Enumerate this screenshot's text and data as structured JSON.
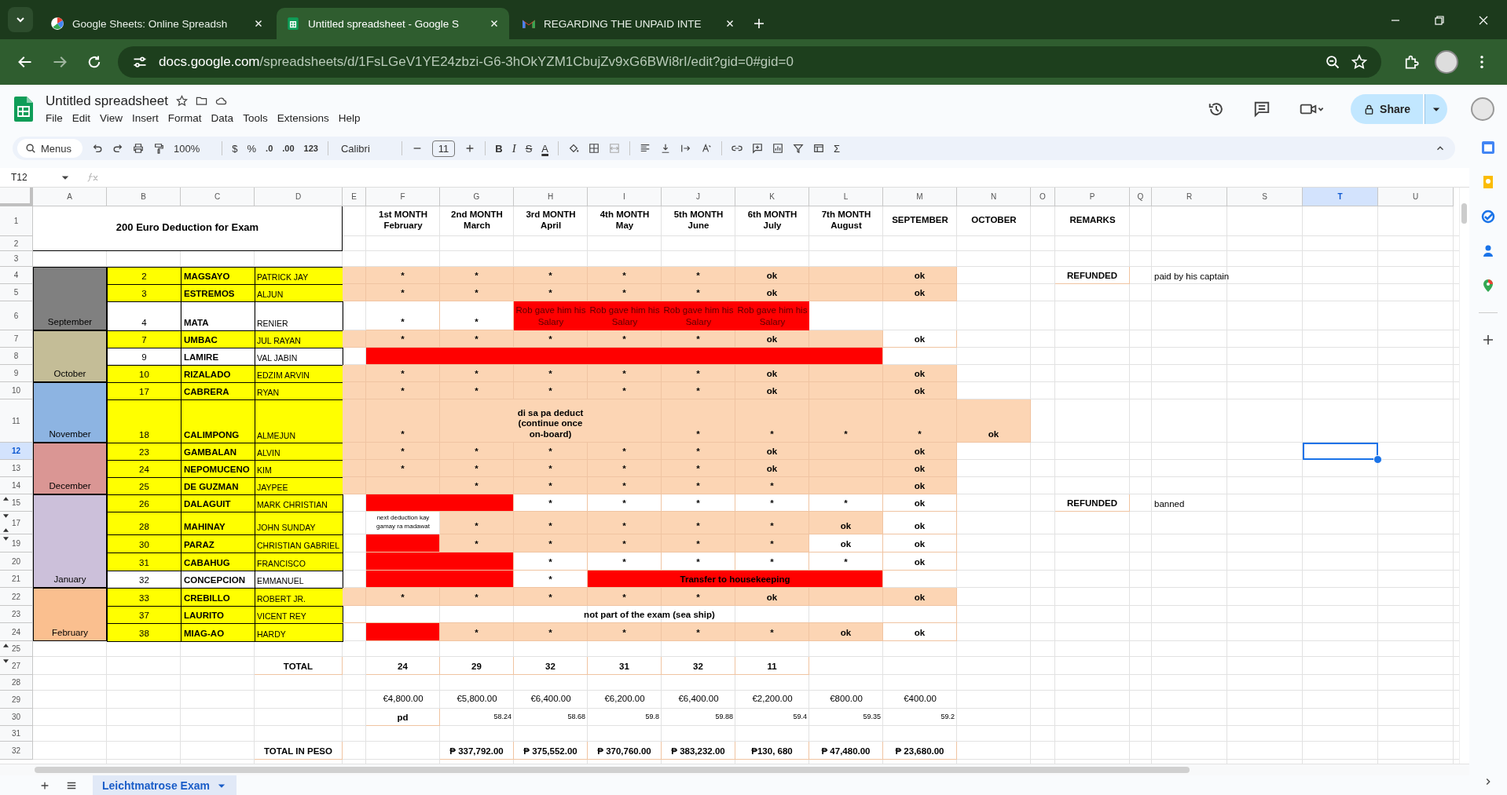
{
  "browser_tabs": [
    {
      "title": "Google Sheets: Online Spreadsh",
      "selected": false,
      "kind": "circle"
    },
    {
      "title": "Untitled spreadsheet - Google S",
      "selected": true,
      "kind": "sheet"
    },
    {
      "title": "REGARDING THE UNPAID INTE",
      "selected": false,
      "kind": "mail"
    }
  ],
  "address": {
    "host": "docs.google.com",
    "path": "/spreadsheets/d/1FsLGeV1YE24zbzi-G6-3hOkYZM1CbujZv9xG6BWi8rI/edit?gid=0#gid=0"
  },
  "doc": {
    "title": "Untitled spreadsheet",
    "menus": [
      "File",
      "Edit",
      "View",
      "Insert",
      "Format",
      "Data",
      "Tools",
      "Extensions",
      "Help"
    ],
    "share": "Share"
  },
  "toolbar": {
    "search": "Menus",
    "zoom": "100%",
    "currency": "$",
    "percent": "%",
    "decrease_decimals": ".0",
    "increase_decimals": ".00",
    "number_format": "123",
    "font": "Calibri",
    "font_size": "11",
    "bold": "B",
    "italic": "I",
    "strikethrough": "S",
    "text_color": "A",
    "sum": "Σ"
  },
  "name_box": "T12",
  "sheet": {
    "columns": [
      {
        "letter": "A",
        "selected": false
      },
      {
        "letter": "B",
        "selected": false
      },
      {
        "letter": "C",
        "selected": false
      },
      {
        "letter": "D",
        "selected": false
      },
      {
        "letter": "E",
        "selected": false
      },
      {
        "letter": "F",
        "selected": false
      },
      {
        "letter": "G",
        "selected": false
      },
      {
        "letter": "H",
        "selected": false
      },
      {
        "letter": "I",
        "selected": false
      },
      {
        "letter": "J",
        "selected": false
      },
      {
        "letter": "K",
        "selected": false
      },
      {
        "letter": "L",
        "selected": false
      },
      {
        "letter": "M",
        "selected": false
      },
      {
        "letter": "N",
        "selected": false
      },
      {
        "letter": "O",
        "selected": false
      },
      {
        "letter": "P",
        "selected": false
      },
      {
        "letter": "Q",
        "selected": false
      },
      {
        "letter": "R",
        "selected": false
      },
      {
        "letter": "S",
        "selected": false
      },
      {
        "letter": "T",
        "selected": true
      },
      {
        "letter": "U",
        "selected": false
      }
    ],
    "rows": [
      {
        "number": "1",
        "selected": false,
        "cells": {
          "A": {
            "kind": "title",
            "text": "200 Euro Deduction for Exam"
          },
          "B": {
            "kind": "joined"
          },
          "C": {
            "kind": "joined"
          },
          "D": {
            "kind": "joined"
          },
          "F": {
            "kind": "header",
            "text": "1st MONTH\nFebruary"
          },
          "G": {
            "kind": "header",
            "text": "2nd MONTH\nMarch"
          },
          "H": {
            "kind": "header",
            "text": "3rd MONTH\nApril"
          },
          "I": {
            "kind": "header",
            "text": "4th MONTH\nMay"
          },
          "J": {
            "kind": "header",
            "text": "5th MONTH\nJune"
          },
          "K": {
            "kind": "header",
            "text": "6th MONTH\nJuly"
          },
          "L": {
            "kind": "header",
            "text": "7th MONTH\nAugust"
          },
          "M": {
            "kind": "header",
            "text": "SEPTEMBER"
          },
          "N": {
            "kind": "header",
            "text": "OCTOBER"
          },
          "P": {
            "kind": "header",
            "text": "REMARKS"
          }
        }
      },
      {
        "number": "2",
        "selected": false
      },
      {
        "number": "3",
        "selected": false
      },
      {
        "number": "4",
        "selected": false,
        "cells": {
          "A": {
            "kind": "month",
            "color": "#808080"
          },
          "B": {
            "kind": "number",
            "text": "2",
            "color": "#ffff00"
          },
          "C": {
            "kind": "surname",
            "text": "MAGSAYO",
            "color": "#ffff00"
          },
          "D": {
            "kind": "given",
            "text": "PATRICK JAY",
            "color": "#ffff00"
          },
          "E": {
            "kind": "fill",
            "color": "#fcd5b4"
          },
          "F": {
            "kind": "mark",
            "text": "*",
            "color": "#fcd5b4"
          },
          "G": {
            "kind": "mark",
            "text": "*",
            "color": "#fcd5b4"
          },
          "H": {
            "kind": "mark",
            "text": "*",
            "color": "#fcd5b4"
          },
          "I": {
            "kind": "mark",
            "text": "*",
            "color": "#fcd5b4"
          },
          "J": {
            "kind": "mark",
            "text": "*",
            "color": "#fcd5b4"
          },
          "K": {
            "kind": "mark",
            "text": "ok",
            "color": "#fcd5b4"
          },
          "L": {
            "kind": "fill",
            "color": "#fcd5b4"
          },
          "M": {
            "kind": "mark",
            "text": "ok",
            "color": "#fcd5b4"
          },
          "P": {
            "kind": "mark",
            "text": "REFUNDED"
          },
          "R": {
            "kind": "remark",
            "text": "paid by his captain"
          }
        }
      },
      {
        "number": "5",
        "selected": false,
        "cells": {
          "A": {
            "kind": "month",
            "color": "#808080"
          },
          "B": {
            "kind": "number",
            "text": "3",
            "color": "#ffff00"
          },
          "C": {
            "kind": "surname",
            "text": "ESTREMOS",
            "color": "#ffff00"
          },
          "D": {
            "kind": "given",
            "text": "ALJUN",
            "color": "#ffff00"
          },
          "E": {
            "kind": "fill",
            "color": "#fcd5b4"
          },
          "F": {
            "kind": "mark",
            "text": "*",
            "color": "#fcd5b4"
          },
          "G": {
            "kind": "mark",
            "text": "*",
            "color": "#fcd5b4"
          },
          "H": {
            "kind": "mark",
            "text": "*",
            "color": "#fcd5b4"
          },
          "I": {
            "kind": "mark",
            "text": "*",
            "color": "#fcd5b4"
          },
          "J": {
            "kind": "mark",
            "text": "*",
            "color": "#fcd5b4"
          },
          "K": {
            "kind": "mark",
            "text": "ok",
            "color": "#fcd5b4"
          },
          "L": {
            "kind": "fill",
            "color": "#fcd5b4"
          },
          "M": {
            "kind": "mark",
            "text": "ok",
            "color": "#fcd5b4"
          }
        }
      },
      {
        "number": "6",
        "selected": false,
        "cells": {
          "A": {
            "kind": "month",
            "text": "September",
            "color": "#808080"
          },
          "B": {
            "kind": "number",
            "text": "4"
          },
          "C": {
            "kind": "surname",
            "text": "MATA"
          },
          "D": {
            "kind": "given",
            "text": "RENIER"
          },
          "F": {
            "kind": "mark",
            "text": "*"
          },
          "G": {
            "kind": "mark",
            "text": "*"
          },
          "H": {
            "kind": "banner",
            "text": "Rob gave him his Salary",
            "color": "#ff0000"
          },
          "I": {
            "kind": "banner",
            "text": "Rob gave him his Salary",
            "color": "#ff0000"
          },
          "J": {
            "kind": "banner",
            "text": "Rob gave him his Salary",
            "color": "#ff0000"
          },
          "K": {
            "kind": "banner",
            "text": "Rob gave him his Salary",
            "color": "#ff0000"
          }
        }
      },
      {
        "number": "7",
        "selected": false,
        "cells": {
          "A": {
            "kind": "month",
            "color": "#c4bd97"
          },
          "B": {
            "kind": "number",
            "text": "7",
            "color": "#ffff00"
          },
          "C": {
            "kind": "surname",
            "text": "UMBAC",
            "color": "#ffff00"
          },
          "D": {
            "kind": "given",
            "text": "JUL RAYAN",
            "color": "#ffff00"
          },
          "E": {
            "kind": "fill",
            "color": "#fcd5b4"
          },
          "F": {
            "kind": "mark",
            "text": "*",
            "color": "#fcd5b4"
          },
          "G": {
            "kind": "mark",
            "text": "*",
            "color": "#fcd5b4"
          },
          "H": {
            "kind": "mark",
            "text": "*",
            "color": "#fcd5b4"
          },
          "I": {
            "kind": "mark",
            "text": "*",
            "color": "#fcd5b4"
          },
          "J": {
            "kind": "mark",
            "text": "*",
            "color": "#fcd5b4"
          },
          "K": {
            "kind": "mark",
            "text": "ok",
            "color": "#fcd5b4"
          },
          "L": {
            "kind": "fill",
            "color": "#fcd5b4"
          },
          "M": {
            "kind": "mark",
            "text": "ok"
          }
        }
      },
      {
        "number": "8",
        "selected": false,
        "cells": {
          "A": {
            "kind": "month",
            "color": "#c4bd97"
          },
          "B": {
            "kind": "number",
            "text": "9"
          },
          "C": {
            "kind": "surname",
            "text": "LAMIRE"
          },
          "D": {
            "kind": "given",
            "text": "VAL JABIN"
          },
          "F": {
            "kind": "fill",
            "color": "#ff0000"
          },
          "G": {
            "kind": "joined"
          },
          "H": {
            "kind": "joined"
          },
          "I": {
            "kind": "joined"
          },
          "J": {
            "kind": "joined"
          },
          "K": {
            "kind": "joined"
          },
          "L": {
            "kind": "joined"
          }
        }
      },
      {
        "number": "9",
        "selected": false,
        "cells": {
          "A": {
            "kind": "month",
            "text": "October",
            "color": "#c4bd97"
          },
          "B": {
            "kind": "number",
            "text": "10",
            "color": "#ffff00"
          },
          "C": {
            "kind": "surname",
            "text": "RIZALADO",
            "color": "#ffff00"
          },
          "D": {
            "kind": "given",
            "text": "EDZIM ARVIN",
            "color": "#ffff00"
          },
          "E": {
            "kind": "fill",
            "color": "#fcd5b4"
          },
          "F": {
            "kind": "mark",
            "text": "*",
            "color": "#fcd5b4"
          },
          "G": {
            "kind": "mark",
            "text": "*",
            "color": "#fcd5b4"
          },
          "H": {
            "kind": "mark",
            "text": "*",
            "color": "#fcd5b4"
          },
          "I": {
            "kind": "mark",
            "text": "*",
            "color": "#fcd5b4"
          },
          "J": {
            "kind": "mark",
            "text": "*",
            "color": "#fcd5b4"
          },
          "K": {
            "kind": "mark",
            "text": "ok",
            "color": "#fcd5b4"
          },
          "L": {
            "kind": "fill",
            "color": "#fcd5b4"
          },
          "M": {
            "kind": "mark",
            "text": "ok",
            "color": "#fcd5b4"
          }
        }
      },
      {
        "number": "10",
        "selected": false,
        "cells": {
          "A": {
            "kind": "month",
            "color": "#8db4e2"
          },
          "B": {
            "kind": "number",
            "text": "17",
            "color": "#ffff00"
          },
          "C": {
            "kind": "surname",
            "text": "CABRERA",
            "color": "#ffff00"
          },
          "D": {
            "kind": "given",
            "text": "RYAN",
            "color": "#ffff00"
          },
          "E": {
            "kind": "fill",
            "color": "#fcd5b4"
          },
          "F": {
            "kind": "mark",
            "text": "*",
            "color": "#fcd5b4"
          },
          "G": {
            "kind": "mark",
            "text": "*",
            "color": "#fcd5b4"
          },
          "H": {
            "kind": "mark",
            "text": "*",
            "color": "#fcd5b4"
          },
          "I": {
            "kind": "mark",
            "text": "*",
            "color": "#fcd5b4"
          },
          "J": {
            "kind": "mark",
            "text": "*",
            "color": "#fcd5b4"
          },
          "K": {
            "kind": "mark",
            "text": "ok",
            "color": "#fcd5b4"
          },
          "L": {
            "kind": "fill",
            "color": "#fcd5b4"
          },
          "M": {
            "kind": "mark",
            "text": "ok",
            "color": "#fcd5b4"
          }
        }
      },
      {
        "number": "11",
        "selected": false,
        "cells": {
          "A": {
            "kind": "month",
            "text": "November",
            "color": "#8db4e2"
          },
          "B": {
            "kind": "number",
            "text": "18",
            "color": "#ffff00"
          },
          "C": {
            "kind": "surname",
            "text": "CALIMPONG",
            "color": "#ffff00"
          },
          "D": {
            "kind": "given",
            "text": "ALMEJUN",
            "color": "#ffff00"
          },
          "E": {
            "kind": "fill",
            "color": "#fcd5b4"
          },
          "F": {
            "kind": "mark",
            "text": "*",
            "color": "#fcd5b4"
          },
          "G": {
            "kind": "mark",
            "text": "di sa pa deduct\n(continue once\non-board)",
            "color": "#fcd5b4"
          },
          "H": {
            "kind": "joined"
          },
          "I": {
            "kind": "joined"
          },
          "J": {
            "kind": "mark",
            "text": "*",
            "color": "#fcd5b4"
          },
          "K": {
            "kind": "mark",
            "text": "*",
            "color": "#fcd5b4"
          },
          "L": {
            "kind": "mark",
            "text": "*",
            "color": "#fcd5b4"
          },
          "M": {
            "kind": "mark",
            "text": "*",
            "color": "#fcd5b4"
          },
          "N": {
            "kind": "mark",
            "text": "ok",
            "color": "#fcd5b4"
          }
        }
      },
      {
        "number": "12",
        "selected": true,
        "cells": {
          "A": {
            "kind": "month",
            "color": "#da9694"
          },
          "B": {
            "kind": "number",
            "text": "23",
            "color": "#ffff00"
          },
          "C": {
            "kind": "surname",
            "text": "GAMBALAN",
            "color": "#ffff00"
          },
          "D": {
            "kind": "given",
            "text": "ALVIN",
            "color": "#ffff00"
          },
          "E": {
            "kind": "fill",
            "color": "#fcd5b4"
          },
          "F": {
            "kind": "mark",
            "text": "*",
            "color": "#fcd5b4"
          },
          "G": {
            "kind": "mark",
            "text": "*",
            "color": "#fcd5b4"
          },
          "H": {
            "kind": "mark",
            "text": "*",
            "color": "#fcd5b4"
          },
          "I": {
            "kind": "mark",
            "text": "*",
            "color": "#fcd5b4"
          },
          "J": {
            "kind": "mark",
            "text": "*",
            "color": "#fcd5b4"
          },
          "K": {
            "kind": "mark",
            "text": "ok",
            "color": "#fcd5b4"
          },
          "L": {
            "kind": "fill",
            "color": "#fcd5b4"
          },
          "M": {
            "kind": "mark",
            "text": "ok",
            "color": "#fcd5b4"
          }
        }
      },
      {
        "number": "13",
        "selected": false,
        "cells": {
          "A": {
            "kind": "month",
            "color": "#da9694"
          },
          "B": {
            "kind": "number",
            "text": "24",
            "color": "#ffff00"
          },
          "C": {
            "kind": "surname",
            "text": "NEPOMUCENO",
            "color": "#ffff00"
          },
          "D": {
            "kind": "given",
            "text": "KIM",
            "color": "#ffff00"
          },
          "E": {
            "kind": "fill",
            "color": "#fcd5b4"
          },
          "F": {
            "kind": "mark",
            "text": "*",
            "color": "#fcd5b4"
          },
          "G": {
            "kind": "mark",
            "text": "*",
            "color": "#fcd5b4"
          },
          "H": {
            "kind": "mark",
            "text": "*",
            "color": "#fcd5b4"
          },
          "I": {
            "kind": "mark",
            "text": "*",
            "color": "#fcd5b4"
          },
          "J": {
            "kind": "mark",
            "text": "*",
            "color": "#fcd5b4"
          },
          "K": {
            "kind": "mark",
            "text": "ok",
            "color": "#fcd5b4"
          },
          "L": {
            "kind": "fill",
            "color": "#fcd5b4"
          },
          "M": {
            "kind": "mark",
            "text": "ok",
            "color": "#fcd5b4"
          }
        }
      },
      {
        "number": "14",
        "selected": false,
        "cells": {
          "A": {
            "kind": "month",
            "text": "December",
            "color": "#da9694"
          },
          "B": {
            "kind": "number",
            "text": "25",
            "color": "#ffff00"
          },
          "C": {
            "kind": "surname",
            "text": "DE GUZMAN",
            "color": "#ffff00"
          },
          "D": {
            "kind": "given",
            "text": "JAYPEE",
            "color": "#ffff00"
          },
          "E": {
            "kind": "fill",
            "color": "#fcd5b4"
          },
          "F": {
            "kind": "fill",
            "color": "#fcd5b4"
          },
          "G": {
            "kind": "mark",
            "text": "*",
            "color": "#fcd5b4"
          },
          "H": {
            "kind": "mark",
            "text": "*",
            "color": "#fcd5b4"
          },
          "I": {
            "kind": "mark",
            "text": "*",
            "color": "#fcd5b4"
          },
          "J": {
            "kind": "mark",
            "text": "*",
            "color": "#fcd5b4"
          },
          "K": {
            "kind": "mark",
            "text": "*",
            "color": "#fcd5b4"
          },
          "L": {
            "kind": "fill",
            "color": "#fcd5b4"
          },
          "M": {
            "kind": "mark",
            "text": "ok",
            "color": "#fcd5b4"
          }
        }
      },
      {
        "number": "15",
        "selected": false,
        "toggles": [
          {
            "kind": "up"
          }
        ],
        "cells": {
          "A": {
            "kind": "month",
            "color": "#ccc0da"
          },
          "B": {
            "kind": "number",
            "text": "26",
            "color": "#ffff00"
          },
          "C": {
            "kind": "surname",
            "text": "DALAGUIT",
            "color": "#ffff00"
          },
          "D": {
            "kind": "given",
            "text": "MARK CHRISTIAN",
            "color": "#ffff00"
          },
          "F": {
            "kind": "fill",
            "color": "#ff0000"
          },
          "G": {
            "kind": "joined"
          },
          "H": {
            "kind": "mark",
            "text": "*"
          },
          "I": {
            "kind": "mark",
            "text": "*"
          },
          "J": {
            "kind": "mark",
            "text": "*"
          },
          "K": {
            "kind": "mark",
            "text": "*"
          },
          "L": {
            "kind": "mark",
            "text": "*"
          },
          "M": {
            "kind": "mark",
            "text": "ok"
          },
          "P": {
            "kind": "mark",
            "text": "REFUNDED"
          },
          "R": {
            "kind": "remark",
            "text": "banned"
          }
        }
      },
      {
        "number": "17",
        "selected": false,
        "toggles": [
          {
            "kind": "down"
          },
          {
            "kind": "up"
          }
        ],
        "cells": {
          "A": {
            "kind": "month",
            "color": "#ccc0da"
          },
          "B": {
            "kind": "number",
            "text": "28",
            "color": "#ffff00"
          },
          "C": {
            "kind": "surname",
            "text": "MAHINAY",
            "color": "#ffff00"
          },
          "D": {
            "kind": "given",
            "text": "JOHN SUNDAY",
            "color": "#ffff00"
          },
          "F": {
            "kind": "note",
            "text": "next deduction kay gamay ra madawat"
          },
          "G": {
            "kind": "mark",
            "text": "*",
            "color": "#fcd5b4"
          },
          "H": {
            "kind": "mark",
            "text": "*",
            "color": "#fcd5b4"
          },
          "I": {
            "kind": "mark",
            "text": "*",
            "color": "#fcd5b4"
          },
          "J": {
            "kind": "mark",
            "text": "*",
            "color": "#fcd5b4"
          },
          "K": {
            "kind": "mark",
            "text": "*",
            "color": "#fcd5b4"
          },
          "L": {
            "kind": "mark",
            "text": "ok",
            "color": "#fcd5b4"
          },
          "M": {
            "kind": "mark",
            "text": "ok"
          }
        }
      },
      {
        "number": "19",
        "selected": false,
        "toggles": [
          {
            "kind": "down"
          }
        ],
        "cells": {
          "A": {
            "kind": "month",
            "color": "#ccc0da"
          },
          "B": {
            "kind": "number",
            "text": "30",
            "color": "#ffff00"
          },
          "C": {
            "kind": "surname",
            "text": "PARAZ",
            "color": "#ffff00"
          },
          "D": {
            "kind": "given",
            "text": "CHRISTIAN GABRIEL",
            "color": "#ffff00"
          },
          "F": {
            "kind": "fill",
            "color": "#ff0000"
          },
          "G": {
            "kind": "mark",
            "text": "*",
            "color": "#fcd5b4"
          },
          "H": {
            "kind": "mark",
            "text": "*",
            "color": "#fcd5b4"
          },
          "I": {
            "kind": "mark",
            "text": "*",
            "color": "#fcd5b4"
          },
          "J": {
            "kind": "mark",
            "text": "*",
            "color": "#fcd5b4"
          },
          "K": {
            "kind": "mark",
            "text": "*",
            "color": "#fcd5b4"
          },
          "L": {
            "kind": "mark",
            "text": "ok"
          },
          "M": {
            "kind": "mark",
            "text": "ok"
          }
        }
      },
      {
        "number": "20",
        "selected": false,
        "cells": {
          "A": {
            "kind": "month",
            "color": "#ccc0da"
          },
          "B": {
            "kind": "number",
            "text": "31",
            "color": "#ffff00"
          },
          "C": {
            "kind": "surname",
            "text": "CABAHUG",
            "color": "#ffff00"
          },
          "D": {
            "kind": "given",
            "text": "FRANCISCO",
            "color": "#ffff00"
          },
          "F": {
            "kind": "fill",
            "color": "#ff0000"
          },
          "G": {
            "kind": "joined"
          },
          "H": {
            "kind": "mark",
            "text": "*"
          },
          "I": {
            "kind": "mark",
            "text": "*"
          },
          "J": {
            "kind": "mark",
            "text": "*"
          },
          "K": {
            "kind": "mark",
            "text": "*"
          },
          "L": {
            "kind": "mark",
            "text": "*"
          },
          "M": {
            "kind": "mark",
            "text": "ok"
          }
        }
      },
      {
        "number": "21",
        "selected": false,
        "cells": {
          "A": {
            "kind": "month",
            "text": "January",
            "color": "#ccc0da"
          },
          "B": {
            "kind": "number",
            "text": "32"
          },
          "C": {
            "kind": "surname",
            "text": "CONCEPCION"
          },
          "D": {
            "kind": "given",
            "text": "EMMANUEL"
          },
          "F": {
            "kind": "fill",
            "color": "#ff0000"
          },
          "G": {
            "kind": "joined"
          },
          "H": {
            "kind": "mark",
            "text": "*"
          },
          "I": {
            "kind": "mark",
            "text": "Transfer to housekeeping",
            "color": "#ff0000"
          },
          "J": {
            "kind": "joined"
          },
          "K": {
            "kind": "joined"
          },
          "L": {
            "kind": "joined"
          }
        }
      },
      {
        "number": "22",
        "selected": false,
        "cells": {
          "A": {
            "kind": "month",
            "color": "#fabf8f"
          },
          "B": {
            "kind": "number",
            "text": "33",
            "color": "#ffff00"
          },
          "C": {
            "kind": "surname",
            "text": "CREBILLO",
            "color": "#ffff00"
          },
          "D": {
            "kind": "given",
            "text": "ROBERT JR.",
            "color": "#ffff00"
          },
          "E": {
            "kind": "fill",
            "color": "#fcd5b4"
          },
          "F": {
            "kind": "mark",
            "text": "*",
            "color": "#fcd5b4"
          },
          "G": {
            "kind": "mark",
            "text": "*",
            "color": "#fcd5b4"
          },
          "H": {
            "kind": "mark",
            "text": "*",
            "color": "#fcd5b4"
          },
          "I": {
            "kind": "mark",
            "text": "*",
            "color": "#fcd5b4"
          },
          "J": {
            "kind": "mark",
            "text": "*",
            "color": "#fcd5b4"
          },
          "K": {
            "kind": "mark",
            "text": "ok",
            "color": "#fcd5b4"
          },
          "L": {
            "kind": "fill",
            "color": "#fcd5b4"
          },
          "M": {
            "kind": "mark",
            "text": "ok",
            "color": "#fcd5b4"
          }
        }
      },
      {
        "number": "23",
        "selected": false,
        "cells": {
          "A": {
            "kind": "month",
            "color": "#fabf8f"
          },
          "B": {
            "kind": "number",
            "text": "37",
            "color": "#ffff00"
          },
          "C": {
            "kind": "surname",
            "text": "LAURITO",
            "color": "#ffff00"
          },
          "D": {
            "kind": "given",
            "text": "VICENT REY",
            "color": "#ffff00"
          },
          "E": {
            "kind": "mark",
            "text": "not part of the exam (sea ship)"
          },
          "F": {
            "kind": "joined"
          },
          "G": {
            "kind": "joined"
          },
          "H": {
            "kind": "joined"
          },
          "I": {
            "kind": "joined"
          },
          "J": {
            "kind": "joined"
          },
          "K": {
            "kind": "joined"
          },
          "L": {
            "kind": "joined"
          },
          "M": {
            "kind": "joined"
          }
        }
      },
      {
        "number": "24",
        "selected": false,
        "cells": {
          "A": {
            "kind": "month",
            "text": "February",
            "color": "#fabf8f"
          },
          "B": {
            "kind": "number",
            "text": "38",
            "color": "#ffff00"
          },
          "C": {
            "kind": "surname",
            "text": "MIAG-AO",
            "color": "#ffff00"
          },
          "D": {
            "kind": "given",
            "text": "HARDY",
            "color": "#ffff00"
          },
          "F": {
            "kind": "fill",
            "color": "#ff0000"
          },
          "G": {
            "kind": "mark",
            "text": "*",
            "color": "#fcd5b4"
          },
          "H": {
            "kind": "mark",
            "text": "*",
            "color": "#fcd5b4"
          },
          "I": {
            "kind": "mark",
            "text": "*",
            "color": "#fcd5b4"
          },
          "J": {
            "kind": "mark",
            "text": "*",
            "color": "#fcd5b4"
          },
          "K": {
            "kind": "mark",
            "text": "*",
            "color": "#fcd5b4"
          },
          "L": {
            "kind": "mark",
            "text": "ok",
            "color": "#fcd5b4"
          },
          "M": {
            "kind": "mark",
            "text": "ok"
          }
        }
      },
      {
        "number": "25",
        "selected": false,
        "toggles": [
          {
            "kind": "up"
          }
        ]
      },
      {
        "number": "27",
        "selected": false,
        "toggles": [
          {
            "kind": "down"
          }
        ],
        "cells": {
          "D": {
            "kind": "mark",
            "text": "TOTAL"
          },
          "F": {
            "kind": "mark",
            "text": "24"
          },
          "G": {
            "kind": "mark",
            "text": "29"
          },
          "H": {
            "kind": "mark",
            "text": "32"
          },
          "I": {
            "kind": "mark",
            "text": "31"
          },
          "J": {
            "kind": "mark",
            "text": "32"
          },
          "K": {
            "kind": "mark",
            "text": "11"
          }
        }
      },
      {
        "number": "28",
        "selected": false
      },
      {
        "number": "29",
        "selected": false,
        "cells": {
          "F": {
            "kind": "amount",
            "text": "€4,800.00"
          },
          "G": {
            "kind": "amount",
            "text": "€5,800.00"
          },
          "H": {
            "kind": "amount",
            "text": "€6,400.00"
          },
          "I": {
            "kind": "amount",
            "text": "€6,200.00"
          },
          "J": {
            "kind": "amount",
            "text": "€6,400.00"
          },
          "K": {
            "kind": "amount",
            "text": "€2,200.00"
          },
          "L": {
            "kind": "amount",
            "text": "€800.00"
          },
          "M": {
            "kind": "amount",
            "text": "€400.00"
          }
        }
      },
      {
        "number": "30",
        "selected": false,
        "cells": {
          "F": {
            "kind": "mark",
            "text": "pd"
          },
          "G": {
            "kind": "rate",
            "text": "58.24"
          },
          "H": {
            "kind": "rate",
            "text": "58.68"
          },
          "I": {
            "kind": "rate",
            "text": "59.8"
          },
          "J": {
            "kind": "rate",
            "text": "59.88"
          },
          "K": {
            "kind": "rate",
            "text": "59.4"
          },
          "L": {
            "kind": "rate",
            "text": "59.35"
          },
          "M": {
            "kind": "rate",
            "text": "59.2"
          }
        }
      },
      {
        "number": "31",
        "selected": false
      },
      {
        "number": "32",
        "selected": false,
        "cells": {
          "D": {
            "kind": "mark",
            "text": "TOTAL IN PESO"
          },
          "G": {
            "kind": "mark",
            "text": "₱ 337,792.00"
          },
          "H": {
            "kind": "mark",
            "text": "₱ 375,552.00"
          },
          "I": {
            "kind": "mark",
            "text": "₱ 370,760.00"
          },
          "J": {
            "kind": "mark",
            "text": "₱ 383,232.00"
          },
          "K": {
            "kind": "mark",
            "text": "₱130, 680"
          },
          "L": {
            "kind": "mark",
            "text": "₱ 47,480.00"
          },
          "M": {
            "kind": "mark",
            "text": "₱ 23,680.00"
          }
        }
      }
    ]
  },
  "sheet_tabs": [
    {
      "label": "Leichtmatrose Exam",
      "selected": true
    }
  ]
}
